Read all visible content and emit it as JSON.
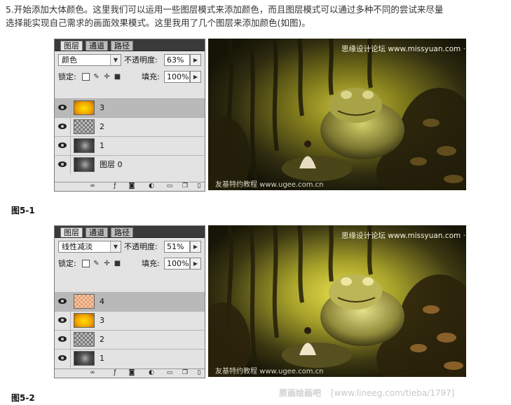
{
  "intro": {
    "line1": "5.开始添加大体颜色。这里我们可以运用一些图层模式来添加颜色，而且图层模式可以通过多种不同的尝试来尽量",
    "line2": "选择能实现自己需求的画面效果模式。这里我用了几个图层来添加颜色(如图)。"
  },
  "figures": [
    {
      "caption": "图5-1",
      "panel": {
        "tabs": [
          "图层",
          "通道",
          "路径"
        ],
        "blend_mode": "颜色",
        "opacity_label": "不透明度:",
        "opacity_value": "63%",
        "lock_label": "锁定:",
        "fill_label": "填充:",
        "fill_value": "100%",
        "layers": [
          {
            "name": "3",
            "thumb": "gold",
            "selected": true
          },
          {
            "name": "2",
            "thumb": "checker-dark",
            "selected": false
          },
          {
            "name": "1",
            "thumb": "dark",
            "selected": false
          },
          {
            "name": "图层 0",
            "thumb": "dark",
            "selected": false
          }
        ]
      },
      "watermark_top": "思缘设计论坛 www.missyuan.com · 友基科技",
      "watermark_bottom": "友基特约教程  www.ugee.com.cn"
    },
    {
      "caption": "图5-2",
      "panel": {
        "tabs": [
          "图层",
          "通道",
          "路径"
        ],
        "blend_mode": "线性减淡",
        "opacity_label": "不透明度:",
        "opacity_value": "51%",
        "lock_label": "锁定:",
        "fill_label": "填充:",
        "fill_value": "100%",
        "layers": [
          {
            "name": "4",
            "thumb": "checker-orange",
            "selected": true
          },
          {
            "name": "3",
            "thumb": "gold",
            "selected": false
          },
          {
            "name": "2",
            "thumb": "checker-dark",
            "selected": false
          },
          {
            "name": "1",
            "thumb": "dark",
            "selected": false
          }
        ]
      },
      "watermark_top": "思缘设计论坛 www.missyuan.com · 友基科技",
      "watermark_bottom": "友基特约教程  www.ugee.com.cn"
    }
  ],
  "footer_watermark": {
    "logo": "原画绘画吧",
    "url": "[www.lineeg.com/tieba/1797]"
  },
  "icons": {
    "eye": "eye-icon",
    "lock_transparent": "lock-transparency-icon",
    "lock_brush": "lock-image-icon",
    "lock_move": "lock-position-icon",
    "lock_all": "lock-all-icon",
    "link": "link-layers-icon",
    "fx": "layer-style-icon",
    "mask": "layer-mask-icon",
    "adjust": "adjustment-layer-icon",
    "group": "new-group-icon",
    "new": "new-layer-icon",
    "trash": "delete-layer-icon"
  },
  "colors": {
    "panel_bg": "#e3e3e3",
    "tabbar_bg": "#3a3a3a",
    "selected_row": "#b9b9b9",
    "art_glow_1": "#c8c23a",
    "art_glow_2": "#a9a347"
  }
}
